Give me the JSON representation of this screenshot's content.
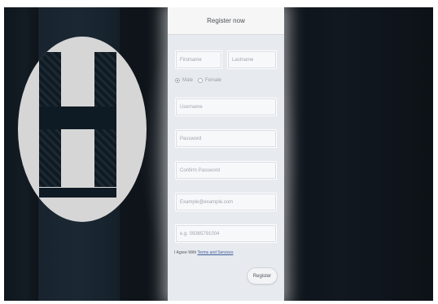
{
  "form": {
    "title": "Register now",
    "firstname_placeholder": "Firstname",
    "lastname_placeholder": "Lastname",
    "gender": {
      "male_label": "Male",
      "female_label": "Female",
      "selected": "Male"
    },
    "username_placeholder": "Username",
    "password_placeholder": "Password",
    "confirm_password_placeholder": "Confirm Password",
    "email_placeholder": "Example@example.com",
    "phone_placeholder": "e.g. 09365791004",
    "agree_text": "I Agree With",
    "terms_link": "Terms and Services",
    "register_button": "Register"
  },
  "logo": {
    "letter": "H"
  },
  "colors": {
    "background": "#0c1116",
    "panel": "#e7eaee",
    "logo_circle": "#d6d6d6",
    "logo_letter": "#0f1b24"
  }
}
